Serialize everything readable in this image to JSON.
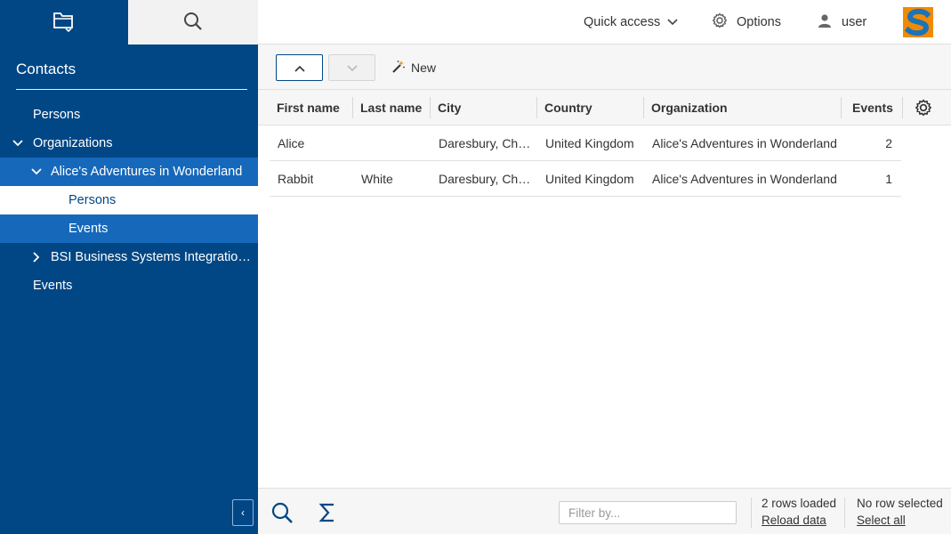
{
  "sidebar": {
    "title": "Contacts",
    "tree": [
      {
        "label": "Persons",
        "expanded": null,
        "selected": false,
        "highlight": false
      },
      {
        "label": "Organizations",
        "expanded": true,
        "selected": false,
        "highlight": false
      },
      {
        "label": "Alice's Adventures in Wonderland",
        "expanded": true,
        "selected": false,
        "highlight": true
      },
      {
        "label": "Persons",
        "expanded": null,
        "selected": true,
        "highlight": false
      },
      {
        "label": "Events",
        "expanded": null,
        "selected": false,
        "highlight": true
      },
      {
        "label": "BSI Business Systems Integration AG",
        "expanded": false,
        "selected": false,
        "highlight": false
      },
      {
        "label": "Events",
        "expanded": null,
        "selected": false,
        "highlight": false
      }
    ],
    "collapse_glyph": "‹"
  },
  "header": {
    "quick_access": "Quick access",
    "options": "Options",
    "user": "user"
  },
  "toolbar": {
    "new_label": "New"
  },
  "table": {
    "columns": [
      "First name",
      "Last name",
      "City",
      "Country",
      "Organization",
      "Events"
    ],
    "rows": [
      [
        "Alice",
        "",
        "Daresbury, Cheshire",
        "United Kingdom",
        "Alice's Adventures in Wonderland",
        "2"
      ],
      [
        "Rabbit",
        "White",
        "Daresbury, Cheshire",
        "United Kingdom",
        "Alice's Adventures in Wonderland",
        "1"
      ]
    ]
  },
  "footer": {
    "filter_placeholder": "Filter by...",
    "rows_loaded": "2 rows loaded",
    "reload": "Reload data",
    "selection": "No row selected",
    "select_all": "Select all"
  },
  "colors": {
    "sidebar_bg": "#014786",
    "sidebar_highlight": "#1668ba",
    "accent": "#014786",
    "logo_orange": "#f08a00",
    "logo_blue": "#1b73b9"
  }
}
